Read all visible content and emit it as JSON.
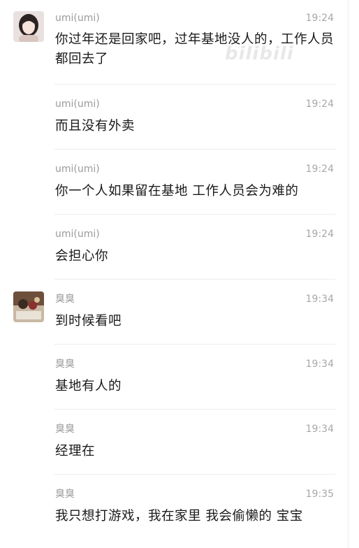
{
  "messages": [
    {
      "sender": "umi(umi)",
      "time": "19:24",
      "text": "你过年还是回家吧，过年基地没人的，工作人员都回去了"
    },
    {
      "sender": "umi(umi)",
      "time": "19:24",
      "text": "而且没有外卖"
    },
    {
      "sender": "umi(umi)",
      "time": "19:24",
      "text": "你一个人如果留在基地 工作人员会为难的"
    },
    {
      "sender": "umi(umi)",
      "time": "19:24",
      "text": "会担心你"
    },
    {
      "sender": "臭臭",
      "time": "19:34",
      "text": "到时候看吧"
    },
    {
      "sender": "臭臭",
      "time": "19:34",
      "text": "基地有人的"
    },
    {
      "sender": "臭臭",
      "time": "19:34",
      "text": "经理在"
    },
    {
      "sender": "臭臭",
      "time": "19:35",
      "text": "我只想打游戏，我在家里 我会偷懒的 宝宝"
    }
  ],
  "watermark": "bilibili"
}
